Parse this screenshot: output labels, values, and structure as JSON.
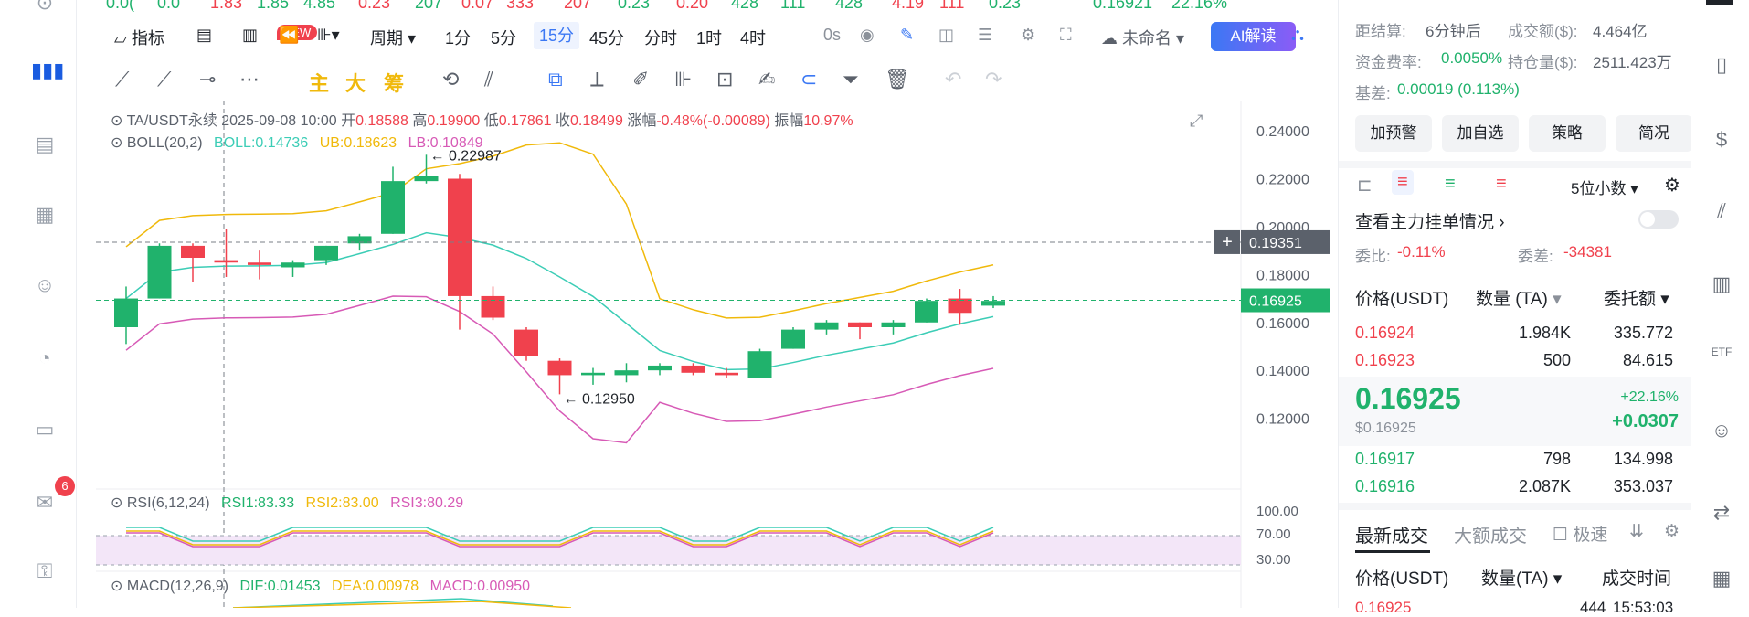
{
  "ticker_strip": {
    "items": [
      {
        "text": "0.0(",
        "color": "#20b26c"
      },
      {
        "text": "0.0",
        "color": "#20b26c"
      },
      {
        "text": "1.83",
        "color": "#f0414d"
      },
      {
        "text": "1.85",
        "color": "#20b26c"
      },
      {
        "text": "4.85",
        "color": "#20b26c"
      },
      {
        "text": "0.23",
        "color": "#f0414d"
      },
      {
        "text": "207",
        "color": "#20b26c"
      },
      {
        "text": "0.07",
        "color": "#f0414d"
      },
      {
        "text": "333",
        "color": "#f0414d"
      },
      {
        "text": "207",
        "color": "#f0414d"
      },
      {
        "text": "0.23",
        "color": "#20b26c"
      },
      {
        "text": "0.20",
        "color": "#f0414d"
      },
      {
        "text": "428",
        "color": "#20b26c"
      },
      {
        "text": "111",
        "color": "#20b26c"
      },
      {
        "text": "428",
        "color": "#20b26c"
      },
      {
        "text": "4.19",
        "color": "#f0414d"
      },
      {
        "text": "111",
        "color": "#f0414d"
      },
      {
        "text": "0.23",
        "color": "#20b26c"
      },
      {
        "text": "0.16921",
        "color": "#20b26c"
      },
      {
        "text": "22.16%",
        "color": "#20b26c"
      }
    ]
  },
  "toolbar": {
    "indicator": "指标",
    "new_badge": "NEW",
    "period": "周期",
    "intervals": [
      "1分",
      "5分",
      "15分",
      "45分",
      "分时",
      "1时",
      "4时"
    ],
    "active_interval": "15分",
    "countdown": "0s",
    "template": "未命名",
    "ai_button": "AI解读"
  },
  "drawing_tools": {
    "main": "主",
    "big": "大",
    "chips": "筹"
  },
  "chart_info": {
    "symbol": "TA/USDT永续",
    "datetime": "2025-09-08 10:00",
    "open_label": "开",
    "open": "0.18588",
    "high_label": "高",
    "high": "0.19900",
    "low_label": "低",
    "low": "0.17861",
    "close_label": "收",
    "close": "0.18499",
    "change_label": "涨幅",
    "change": "-0.48%(-0.00089)",
    "amp_label": "振幅",
    "amp": "10.97%",
    "boll_label": "BOLL(20,2)",
    "boll": "BOLL:0.14736",
    "ub": "UB:0.18623",
    "lb": "LB:0.10849",
    "rsi_label": "RSI(6,12,24)",
    "rsi1": "RSI1:83.33",
    "rsi2": "RSI2:83.00",
    "rsi3": "RSI3:80.29",
    "macd_label": "MACD(12,26,9)",
    "dif": "DIF:0.01453",
    "dea": "DEA:0.00978",
    "macd": "MACD:0.00950",
    "hi_annot": "← 0.22987",
    "lo_annot": "← 0.12950",
    "crosshair_price": "0.19351",
    "last_price": "0.16925",
    "rsi_ticks": [
      "100.00",
      "70.00",
      "30.00"
    ]
  },
  "chart_data": {
    "type": "candlestick",
    "y_ticks": [
      0.24,
      0.22,
      0.2,
      0.18,
      0.16,
      0.14,
      0.12
    ],
    "ylim": [
      0.1,
      0.245
    ],
    "candles": [
      {
        "o": 0.158,
        "h": 0.175,
        "l": 0.151,
        "c": 0.17
      },
      {
        "o": 0.17,
        "h": 0.193,
        "l": 0.17,
        "c": 0.192
      },
      {
        "o": 0.192,
        "h": 0.193,
        "l": 0.177,
        "c": 0.187
      },
      {
        "o": 0.186,
        "h": 0.199,
        "l": 0.179,
        "c": 0.185
      },
      {
        "o": 0.185,
        "h": 0.19,
        "l": 0.178,
        "c": 0.184
      },
      {
        "o": 0.183,
        "h": 0.186,
        "l": 0.179,
        "c": 0.185
      },
      {
        "o": 0.186,
        "h": 0.192,
        "l": 0.184,
        "c": 0.192
      },
      {
        "o": 0.193,
        "h": 0.197,
        "l": 0.19,
        "c": 0.196
      },
      {
        "o": 0.197,
        "h": 0.225,
        "l": 0.197,
        "c": 0.219
      },
      {
        "o": 0.219,
        "h": 0.23,
        "l": 0.218,
        "c": 0.221
      },
      {
        "o": 0.22,
        "h": 0.222,
        "l": 0.157,
        "c": 0.171
      },
      {
        "o": 0.171,
        "h": 0.175,
        "l": 0.161,
        "c": 0.162
      },
      {
        "o": 0.157,
        "h": 0.158,
        "l": 0.144,
        "c": 0.146
      },
      {
        "o": 0.144,
        "h": 0.145,
        "l": 0.13,
        "c": 0.138
      },
      {
        "o": 0.138,
        "h": 0.141,
        "l": 0.134,
        "c": 0.139
      },
      {
        "o": 0.138,
        "h": 0.143,
        "l": 0.135,
        "c": 0.14
      },
      {
        "o": 0.14,
        "h": 0.143,
        "l": 0.138,
        "c": 0.142
      },
      {
        "o": 0.142,
        "h": 0.143,
        "l": 0.138,
        "c": 0.139
      },
      {
        "o": 0.139,
        "h": 0.141,
        "l": 0.137,
        "c": 0.138
      },
      {
        "o": 0.137,
        "h": 0.149,
        "l": 0.137,
        "c": 0.148
      },
      {
        "o": 0.149,
        "h": 0.158,
        "l": 0.149,
        "c": 0.157
      },
      {
        "o": 0.157,
        "h": 0.161,
        "l": 0.155,
        "c": 0.16
      },
      {
        "o": 0.16,
        "h": 0.16,
        "l": 0.153,
        "c": 0.158
      },
      {
        "o": 0.158,
        "h": 0.161,
        "l": 0.155,
        "c": 0.16
      },
      {
        "o": 0.16,
        "h": 0.17,
        "l": 0.16,
        "c": 0.169
      },
      {
        "o": 0.17,
        "h": 0.174,
        "l": 0.159,
        "c": 0.164
      },
      {
        "o": 0.167,
        "h": 0.171,
        "l": 0.166,
        "c": 0.169
      }
    ],
    "colors": {
      "up": "#20b26c",
      "down": "#f0414d",
      "ub": "#f0b90b",
      "mid": "#3ccdb6",
      "lb": "#d75ab6"
    }
  },
  "right_panel": {
    "settle_label": "距结算:",
    "settle": "6分钟后",
    "volume_label": "成交额($):",
    "volume": "4.464亿",
    "funding_label": "资金费率:",
    "funding": "0.0050%",
    "oi_label": "持仓量($):",
    "oi": "2511.423万",
    "basis_label": "基差:",
    "basis": "0.00019 (0.113%)",
    "buttons": [
      "加预警",
      "加自选",
      "策略",
      "简况"
    ],
    "precision": "5位小数",
    "main_orders": "查看主力挂单情况",
    "ratio_label": "委比:",
    "ratio": "-0.11%",
    "diff_label": "委差:",
    "diff": "-34381",
    "col_price": "价格(USDT)",
    "col_qty": "数量 (TA)",
    "col_amount": "委托额",
    "asks": [
      {
        "price": "0.16924",
        "qty": "1.984K",
        "amount": "335.772"
      },
      {
        "price": "0.16923",
        "qty": "500",
        "amount": "84.615"
      }
    ],
    "last": "0.16925",
    "last_usd": "$0.16925",
    "change_pct": "+22.16%",
    "change_abs": "+0.0307",
    "bids": [
      {
        "price": "0.16917",
        "qty": "798",
        "amount": "134.998"
      },
      {
        "price": "0.16916",
        "qty": "2.087K",
        "amount": "353.037"
      }
    ],
    "tab_latest": "最新成交",
    "tab_large": "大额成交",
    "fast_label": "极速",
    "trade_col_price": "价格(USDT)",
    "trade_col_qty": "数量(TA)",
    "trade_col_time": "成交时间",
    "trade_partial": {
      "price": "0.16925",
      "qty": "444",
      "time": "15:53:03"
    }
  }
}
